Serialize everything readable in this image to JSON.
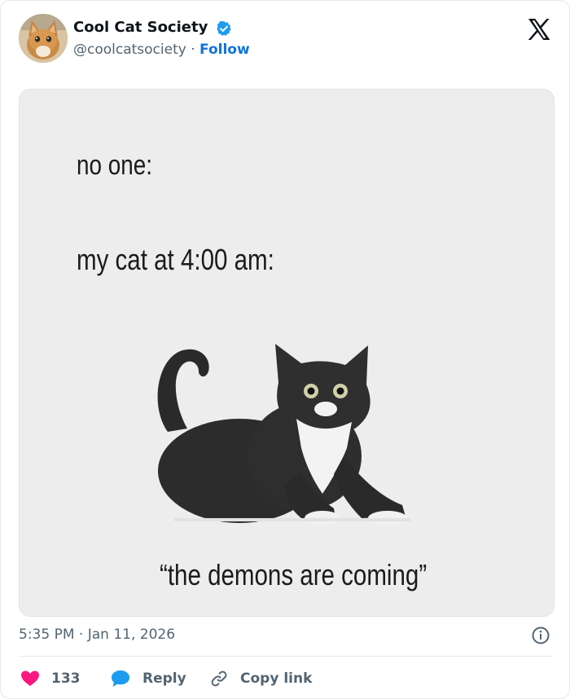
{
  "author": {
    "name": "Cool Cat Society",
    "handle": "@coolcatsociety",
    "separator": "·",
    "follow_label": "Follow",
    "verified": true
  },
  "icons": {
    "verified": "verified-badge-icon",
    "platform": "x-logo-icon",
    "info": "info-icon",
    "like": "heart-icon",
    "reply": "speech-bubble-icon",
    "copy": "link-icon"
  },
  "meme": {
    "line1": "no one:",
    "line2": "my cat at 4:00 am:",
    "caption": "“the demons are coming”"
  },
  "meta": {
    "time": "5:35 PM",
    "separator": "·",
    "date": "Jan 11, 2026"
  },
  "actions": {
    "like_count": "133",
    "reply_label": "Reply",
    "copy_label": "Copy link"
  },
  "colors": {
    "accent_blue": "#0f73d9",
    "like_pink": "#f91880",
    "reply_blue": "#1d9bf0",
    "muted_text": "#536471",
    "media_background": "#ededee"
  }
}
